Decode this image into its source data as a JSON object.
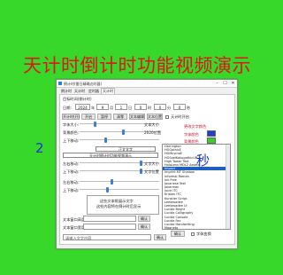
{
  "banner": {
    "title": "天计时倒计时功能视频演示"
  },
  "window": {
    "title": "倒计时(雷日精确达时器)",
    "min": "–",
    "max": "☐",
    "close": "✕"
  },
  "tabs": [
    "倒计时",
    "天计时",
    "定时器",
    "天计时"
  ],
  "section_title": "目标时间(倒计时)",
  "date_row": {
    "label": "日期:",
    "year": "2024",
    "year_unit": "年",
    "month": "9",
    "month_unit": "月",
    "day": "1",
    "day_unit": "日",
    "hour": "0",
    "hour_unit": "时",
    "minute": "0",
    "minute_unit": "分",
    "second": "0",
    "second_unit": "秒"
  },
  "buttons": [
    "开计时(开)",
    "开启",
    "暂停",
    "清零",
    "文本编辑",
    "文本位置"
  ],
  "top_check": "天计时开启",
  "font_rows": [
    {
      "label": "字体大小:",
      "value_label": "文本大小"
    },
    {
      "label": "背景颜色:",
      "value_label": "2020位置"
    },
    {
      "label": "上下移动:",
      "value_label": ""
    }
  ],
  "sample_text": "天计时倒计时功能视频演示",
  "sample_caption": "正文文字",
  "second_rows": [
    {
      "label": "左右移动:",
      "value_label": "文字大小"
    },
    {
      "label": "上下移动:",
      "value_label": "文字位置"
    },
    {
      "label": "左右移动:",
      "value_label": ""
    },
    {
      "label": "上下移动:",
      "value_label": ""
    }
  ],
  "text_area_caption": "这些文本框展示文字",
  "text_area_line2": "这些内容将在倒计时后显示",
  "bottom": {
    "row1_label": "文本窗口高度",
    "row1_btn": "确认",
    "row2_label": "文本窗口宽度",
    "row2_btn": "确认",
    "input_placeholder": "请输入文字内容",
    "input_btn": "确认"
  },
  "right_panel": {
    "heading": "更改文字颜色",
    "font_color": "字体颜色",
    "bg_color": "背景颜色",
    "font_items": [
      "Harrington",
      "HGGothicE",
      "HGMinchoE",
      "HGSoeiKakugothicUB",
      "High Tower Text",
      "HoloLens MDL2 Assets",
      "Impact",
      "Imprint MT Shadow",
      "Informal Roman",
      "Ink Free",
      "Javanese Text",
      "Jokerman",
      "Juice ITC",
      "Kristen ITC",
      "Kunstler Script",
      "Leelawadee",
      "Leelawadee UI",
      "Lucida Bright",
      "Lucida Calligraphy",
      "Lucida Console",
      "Lucida Fax",
      "Lucida Handwriting",
      "Magneto",
      "Malgun Gothic",
      "Marlett"
    ],
    "selected_index": 6,
    "ok": "确认",
    "check_label": "字体变换"
  },
  "colors": {
    "font_color": "#1d3fd6",
    "bg_color": "#35d02a"
  },
  "overlay_time": {
    "left": "2",
    "right": "秒"
  },
  "sliders": {
    "s1": 0.18,
    "s2": 0.55,
    "s3": 0.32,
    "s4": 0.78,
    "s5": 0.78,
    "s6": 0.4,
    "s7": 0.35
  }
}
